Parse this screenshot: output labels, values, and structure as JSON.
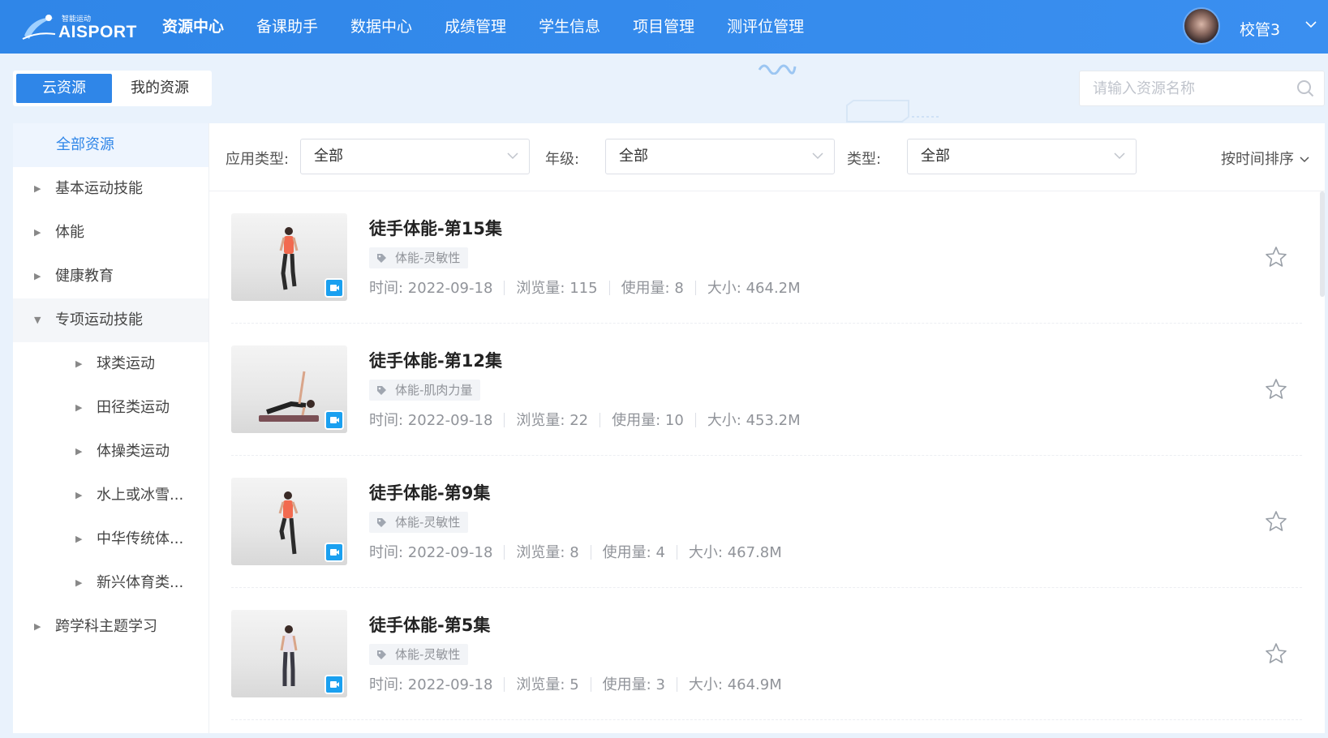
{
  "brand": {
    "logo_small": "智能运动",
    "logo_big": "AISPORT"
  },
  "nav": [
    {
      "label": "资源中心",
      "active": true
    },
    {
      "label": "备课助手"
    },
    {
      "label": "数据中心"
    },
    {
      "label": "成绩管理"
    },
    {
      "label": "学生信息"
    },
    {
      "label": "项目管理"
    },
    {
      "label": "测评位管理"
    }
  ],
  "user": {
    "name": "校管3"
  },
  "tabs": [
    {
      "label": "云资源",
      "active": true
    },
    {
      "label": "我的资源"
    }
  ],
  "search": {
    "placeholder": "请输入资源名称"
  },
  "sidebar": {
    "all": "全部资源",
    "items": [
      {
        "label": "基本运动技能"
      },
      {
        "label": "体能"
      },
      {
        "label": "健康教育"
      },
      {
        "label": "专项运动技能",
        "expanded": true
      },
      {
        "label": "球类运动",
        "sub": true
      },
      {
        "label": "田径类运动",
        "sub": true
      },
      {
        "label": "体操类运动",
        "sub": true
      },
      {
        "label": "水上或冰雪...",
        "sub": true
      },
      {
        "label": "中华传统体...",
        "sub": true
      },
      {
        "label": "新兴体育类...",
        "sub": true
      },
      {
        "label": "跨学科主题学习"
      }
    ]
  },
  "filters": {
    "app_type_label": "应用类型:",
    "app_type_value": "全部",
    "grade_label": "年级:",
    "grade_value": "全部",
    "type_label": "类型:",
    "type_value": "全部",
    "sort_label": "按时间排序"
  },
  "resources": [
    {
      "title": "徒手体能-第15集",
      "tag": "体能-灵敏性",
      "time": "时间: 2022-09-18",
      "views": "浏览量: 115",
      "uses": "使用量: 8",
      "size": "大小: 464.2M"
    },
    {
      "title": "徒手体能-第12集",
      "tag": "体能-肌肉力量",
      "time": "时间: 2022-09-18",
      "views": "浏览量: 22",
      "uses": "使用量: 10",
      "size": "大小: 453.2M"
    },
    {
      "title": "徒手体能-第9集",
      "tag": "体能-灵敏性",
      "time": "时间: 2022-09-18",
      "views": "浏览量: 8",
      "uses": "使用量: 4",
      "size": "大小: 467.8M"
    },
    {
      "title": "徒手体能-第5集",
      "tag": "体能-灵敏性",
      "time": "时间: 2022-09-18",
      "views": "浏览量: 5",
      "uses": "使用量: 3",
      "size": "大小: 464.9M"
    }
  ],
  "colors": {
    "primary": "#2f86e8",
    "video_badge": "#1aa0f0"
  },
  "icons": {
    "search": "search-icon",
    "star": "star-icon",
    "caret": "chevron-down-icon",
    "tag": "tag-icon",
    "video": "video-icon"
  }
}
